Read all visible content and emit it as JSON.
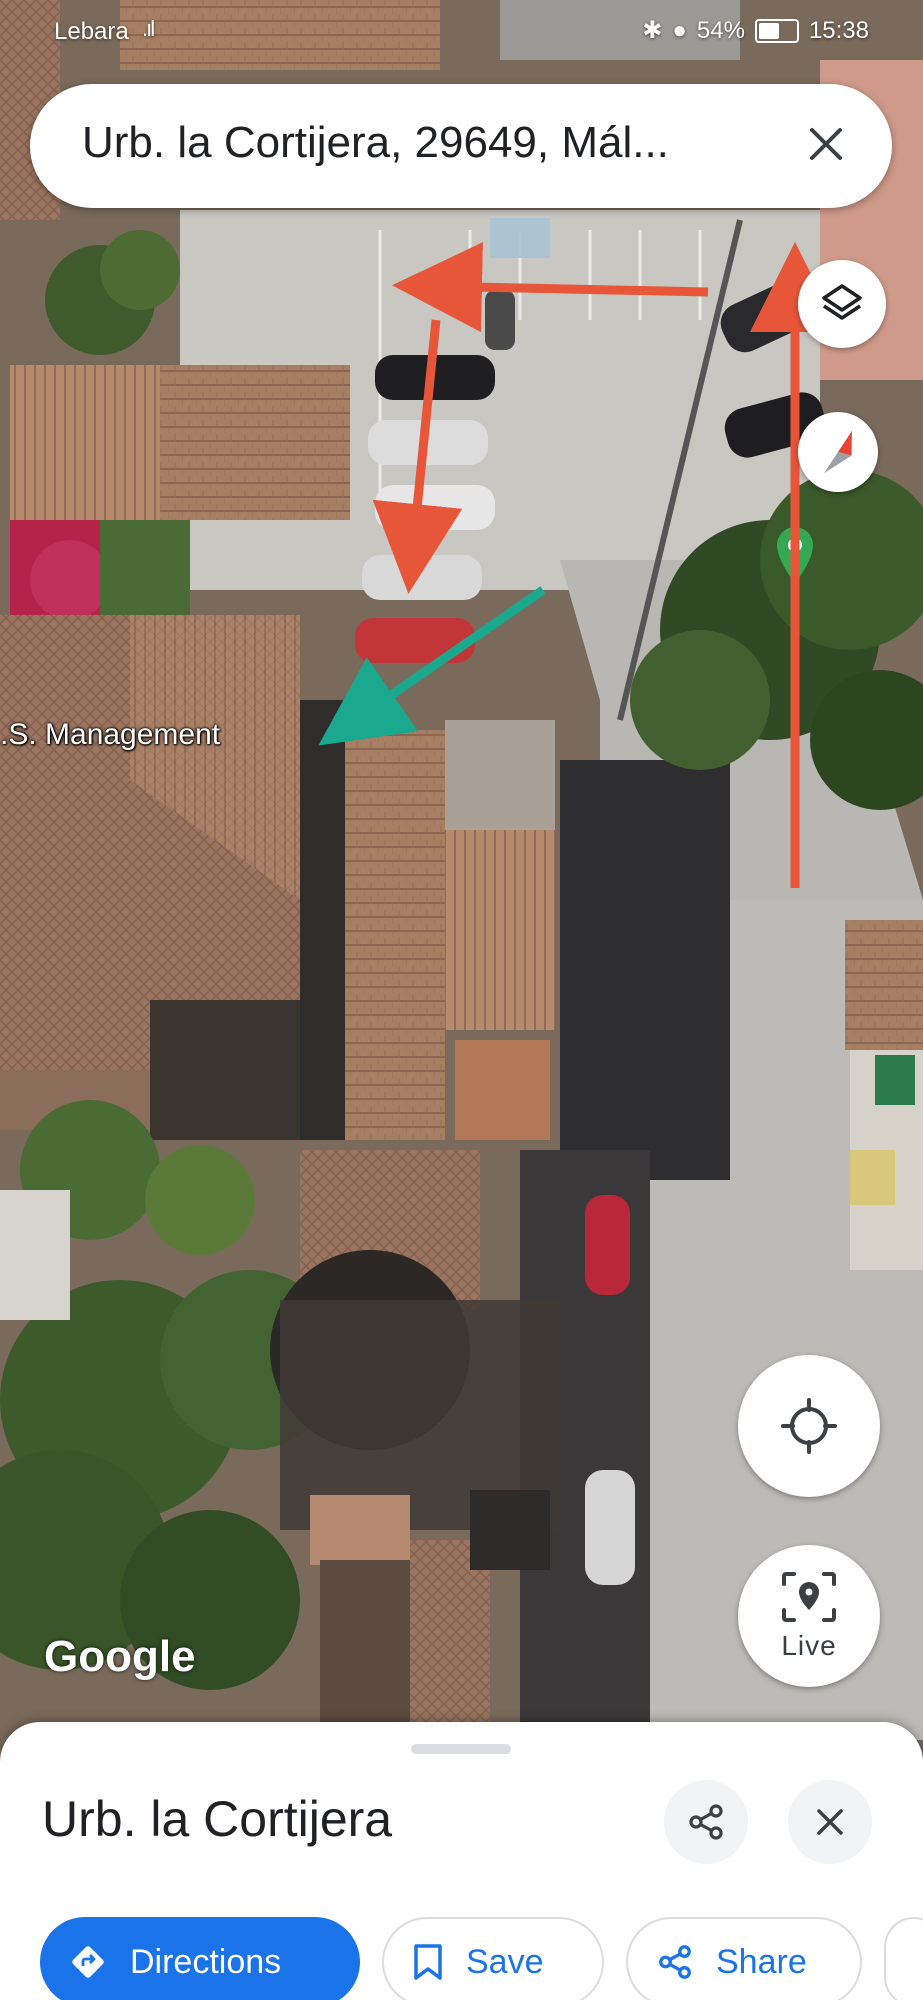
{
  "status_bar": {
    "carrier": "Lebara",
    "signal": ".ıl",
    "battery": "54%",
    "time": "15:38"
  },
  "search": {
    "query": "Urb. la Cortijera, 29649, Mál..."
  },
  "map": {
    "place_label": ".S. Management",
    "attribution": "Google",
    "live_label": "Live",
    "arrow_colors": {
      "route": "#e8563a",
      "pointer": "#1aa98f"
    }
  },
  "sheet": {
    "title": "Urb. la Cortijera",
    "actions": {
      "directions": "Directions",
      "save": "Save",
      "share": "Share"
    }
  },
  "colors": {
    "accent": "#1a73e8"
  }
}
